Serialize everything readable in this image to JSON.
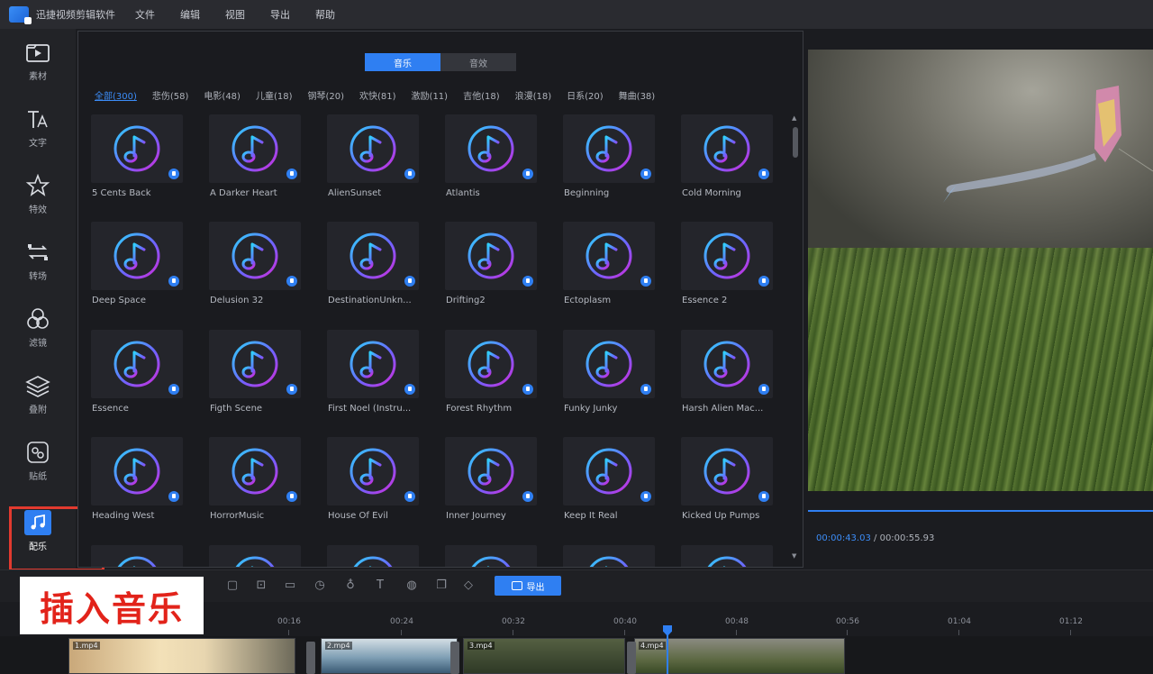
{
  "app": {
    "title": "迅捷视频剪辑软件",
    "menu": [
      "文件",
      "编辑",
      "视图",
      "导出",
      "帮助"
    ]
  },
  "sidebar": {
    "items": [
      {
        "id": "material",
        "label": "素材",
        "icon": "play-folder-icon"
      },
      {
        "id": "text",
        "label": "文字",
        "icon": "text-icon"
      },
      {
        "id": "effects",
        "label": "特效",
        "icon": "star-effect-icon"
      },
      {
        "id": "transition",
        "label": "转场",
        "icon": "transition-icon"
      },
      {
        "id": "filter",
        "label": "滤镜",
        "icon": "filter-circles-icon"
      },
      {
        "id": "overlay",
        "label": "叠附",
        "icon": "layers-icon"
      },
      {
        "id": "sticker",
        "label": "贴纸",
        "icon": "sticker-icon"
      },
      {
        "id": "music",
        "label": "配乐",
        "icon": "music-note-icon",
        "active": true
      }
    ]
  },
  "library": {
    "tabs": [
      "音乐",
      "音效"
    ],
    "active_tab": "音乐",
    "categories": [
      "全部(300)",
      "悲伤(58)",
      "电影(48)",
      "儿童(18)",
      "钢琴(20)",
      "欢快(81)",
      "激励(11)",
      "吉他(18)",
      "浪漫(18)",
      "日系(20)",
      "舞曲(38)"
    ],
    "active_category": "全部(300)",
    "tracks": [
      "5 Cents Back",
      "A Darker Heart",
      "AlienSunset",
      "Atlantis",
      "Beginning",
      "Cold Morning",
      "Deep Space",
      "Delusion 32",
      "DestinationUnkn...",
      "Drifting2",
      "Ectoplasm",
      "Essence 2",
      "Essence",
      "Figth Scene",
      "First Noel (Instru...",
      "Forest Rhythm",
      "Funky Junky",
      "Harsh Alien Mac...",
      "Heading West",
      "HorrorMusic",
      "House Of Evil",
      "Inner Journey",
      "Keep It Real",
      "Kicked Up Pumps",
      "",
      "",
      "",
      "",
      "",
      ""
    ]
  },
  "preview": {
    "current_time": "00:00:43.03",
    "separator": "/",
    "total_time": "00:00:55.93"
  },
  "toolbar": {
    "export_label": "导出",
    "icons": [
      "undo-icon",
      "redo-icon",
      "delete-icon",
      "crop-icon",
      "split-icon",
      "mosaic-icon",
      "speed-icon",
      "record-icon",
      "text-to-speech-icon",
      "color-icon",
      "freeze-icon",
      "marker-icon"
    ]
  },
  "overlay_banner": {
    "text": "插入音乐"
  },
  "timeline": {
    "ticks": [
      "00:16",
      "00:24",
      "00:32",
      "00:40",
      "00:48",
      "00:56",
      "01:04",
      "01:12"
    ],
    "clips": [
      {
        "label": "1.mp4"
      },
      {
        "label": "2.mp4"
      },
      {
        "label": "3.mp4"
      },
      {
        "label": "4.mp4"
      }
    ]
  },
  "colors": {
    "accent": "#2f7ff2",
    "highlight_box": "#e23a2f",
    "banner_text": "#e2231a"
  }
}
